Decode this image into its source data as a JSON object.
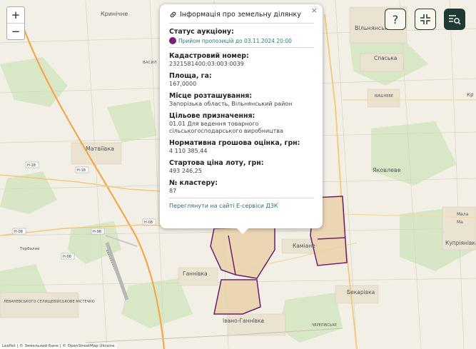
{
  "map": {
    "places": [
      {
        "name": "Кринічне"
      },
      {
        "name": "Вільнянськ"
      },
      {
        "name": "Спаська"
      },
      {
        "name": "Матвіївка"
      },
      {
        "name": "Яковлеве"
      },
      {
        "name": "Каміане"
      },
      {
        "name": "Ганнівка"
      },
      {
        "name": "Бекарівка"
      },
      {
        "name": "Купріянівка"
      },
      {
        "name": "Івано-Ганнівка"
      },
      {
        "name": "Тербалне"
      },
      {
        "name": "ВІЙСЬКОВЕ МІСТЕЧКО"
      },
      {
        "name": "ЛЕВАНЕВСЬКОГО СЕЛИЩЕ"
      },
      {
        "name": "ЧЕРЕПІВСЬКЕ"
      },
      {
        "name": "ВИШНЕВЕ"
      },
      {
        "name": "ВАСИЛ"
      },
      {
        "name": "Мала"
      },
      {
        "name": "Кр"
      },
      {
        "name": "Ма"
      }
    ],
    "road_labels": [
      "H-18",
      "H-18",
      "H-08",
      "H-08",
      "H-08",
      "H-08"
    ],
    "colors": {
      "background": "#f2f0e6",
      "parcel_fill": "#e8cfa6",
      "parcel_border": "#6b1f6b",
      "road_major": "#f0a84a",
      "forest": "#d3e6c0"
    }
  },
  "controls": {
    "zoom_in": "+",
    "zoom_out": "−",
    "help": "?",
    "collapse_icon": "collapse-icon",
    "search_icon": "search-list-icon"
  },
  "popup": {
    "title": "Інформація про земельну ділянку",
    "close": "×",
    "status_label": "Статус аукціону:",
    "status_value": "Прийом пропозицій до 03.11.2024 20:00",
    "cadastral_label": "Кадастровий номер:",
    "cadastral_value": "2321581400:03:003:0039",
    "area_label": "Площа, га:",
    "area_value": "167,0000",
    "location_label": "Місце розташування:",
    "location_value": "Запорізька область, Вільнянський район",
    "purpose_label": "Цільове призначення:",
    "purpose_value": "01.01 Для ведення товарного сільськогосподарського виробництва",
    "valuation_label": "Нормативна грошова оцінка, грн:",
    "valuation_value": "4 110 385,44",
    "start_price_label": "Стартова ціна лоту, грн:",
    "start_price_value": "493 246,25",
    "cluster_label": "№ кластеру:",
    "cluster_value": "87",
    "link": "Переглянути на сайті Е-сервіси ДЗК"
  },
  "attribution": "Leaflet | © Земельний Банк | © OpenStreetMap Ukraine"
}
